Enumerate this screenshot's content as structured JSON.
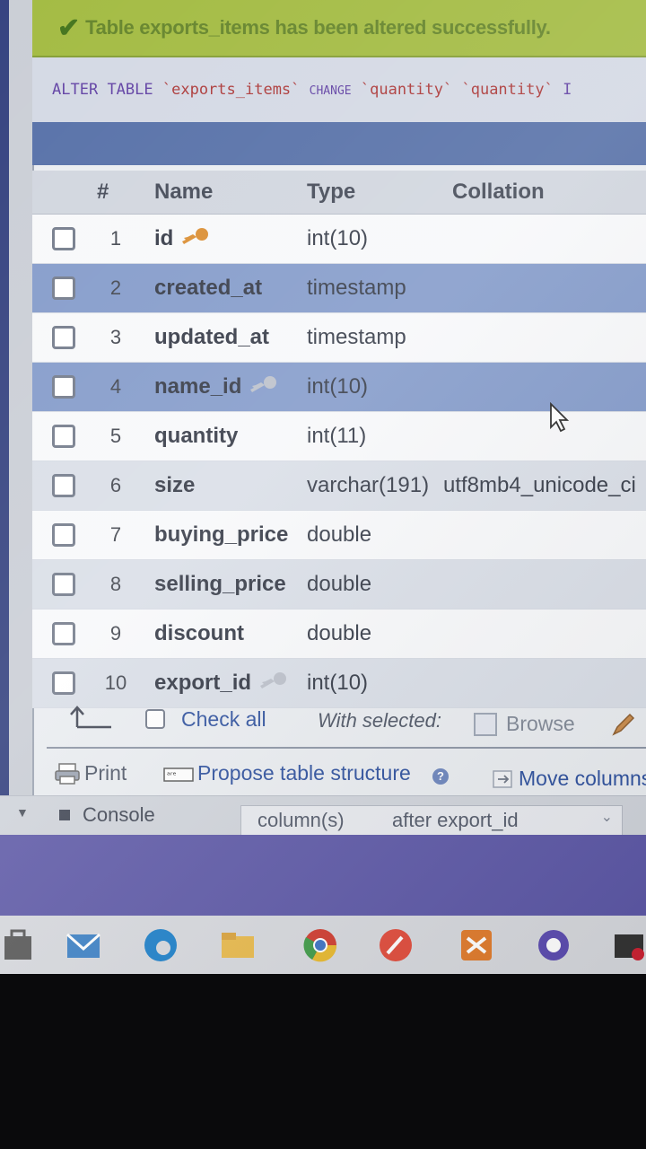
{
  "notification": {
    "success_message": "Table exports_items has been altered successfully.",
    "sql": {
      "kw_alter": "ALTER",
      "kw_table": "TABLE",
      "table": "`exports_items`",
      "kw_change": "CHANGE",
      "old_col": "`quantity`",
      "new_col": "`quantity`",
      "trailing": "I"
    }
  },
  "table": {
    "headers": {
      "num": "#",
      "name": "Name",
      "type": "Type",
      "collation": "Collation"
    },
    "rows": [
      {
        "num": "1",
        "name": "id",
        "type": "int(10)",
        "collation": "",
        "key": true,
        "key_color": "#d9892a"
      },
      {
        "num": "2",
        "name": "created_at",
        "type": "timestamp",
        "collation": "",
        "key": false
      },
      {
        "num": "3",
        "name": "updated_at",
        "type": "timestamp",
        "collation": "",
        "key": false
      },
      {
        "num": "4",
        "name": "name_id",
        "type": "int(10)",
        "collation": "",
        "key": true,
        "key_color": "#b9bec8"
      },
      {
        "num": "5",
        "name": "quantity",
        "type": "int(11)",
        "collation": "",
        "key": false
      },
      {
        "num": "6",
        "name": "size",
        "type": "varchar(191)",
        "collation": "utf8mb4_unicode_ci",
        "key": false
      },
      {
        "num": "7",
        "name": "buying_price",
        "type": "double",
        "collation": "",
        "key": false
      },
      {
        "num": "8",
        "name": "selling_price",
        "type": "double",
        "collation": "",
        "key": false
      },
      {
        "num": "9",
        "name": "discount",
        "type": "double",
        "collation": "",
        "key": false
      },
      {
        "num": "10",
        "name": "export_id",
        "type": "int(10)",
        "collation": "",
        "key": true,
        "key_color": "#b9bec8"
      }
    ]
  },
  "actions": {
    "check_all": "Check all",
    "with_selected": "With selected:",
    "browse": "Browse"
  },
  "footer": {
    "print": "Print",
    "propose": "Propose table structure",
    "move_columns": "Move columns"
  },
  "console_bar": {
    "console": "Console",
    "columns_label": "column(s)",
    "position": "after export_id"
  },
  "colors": {
    "success_bg": "#9fb83a",
    "highlight_row": "#7f97c8",
    "link_blue": "#2b4e9c",
    "desktop_bg": "#5c57a6"
  },
  "taskbar_icons": [
    "store-icon",
    "mail-icon",
    "edge-icon",
    "file-explorer-icon",
    "chrome-icon",
    "app-icon",
    "xampp-icon",
    "github-icon",
    "extra-icon"
  ]
}
